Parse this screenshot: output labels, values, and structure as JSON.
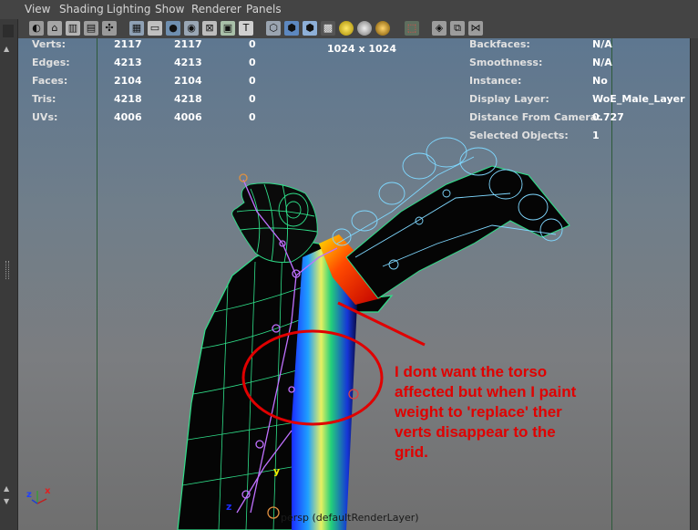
{
  "menu": [
    "View",
    "Shading",
    "Lighting",
    "Show",
    "Renderer",
    "Panels"
  ],
  "hud_left": [
    {
      "label": "Verts:",
      "a": "2117",
      "b": "2117",
      "c": "0"
    },
    {
      "label": "Edges:",
      "a": "4213",
      "b": "4213",
      "c": "0"
    },
    {
      "label": "Faces:",
      "a": "2104",
      "b": "2104",
      "c": "0"
    },
    {
      "label": "Tris:",
      "a": "4218",
      "b": "4218",
      "c": "0"
    },
    {
      "label": "UVs:",
      "a": "4006",
      "b": "4006",
      "c": "0"
    }
  ],
  "resolution": "1024 x 1024",
  "hud_right": [
    {
      "label": "Backfaces:",
      "value": "N/A"
    },
    {
      "label": "Smoothness:",
      "value": "N/A"
    },
    {
      "label": "Instance:",
      "value": "No"
    },
    {
      "label": "Display Layer:",
      "value": "WoE_Male_Layer"
    },
    {
      "label": "Distance From Camera:",
      "value": "0.727"
    },
    {
      "label": "Selected Objects:",
      "value": "1"
    }
  ],
  "camera_label": "persp (defaultRenderLayer)",
  "annotation_lines": [
    "I dont want the torso",
    "affected but when I paint",
    "weight to 'replace' ther",
    "verts disappear to the",
    "grid."
  ],
  "axis": {
    "x": "x",
    "y": "y",
    "z": "z"
  },
  "colors": {
    "annotation": "#e00000",
    "wire_body": "#2fe08a",
    "wire_hand": "#7fd8ff",
    "menu_text": "#d6d6d6"
  }
}
